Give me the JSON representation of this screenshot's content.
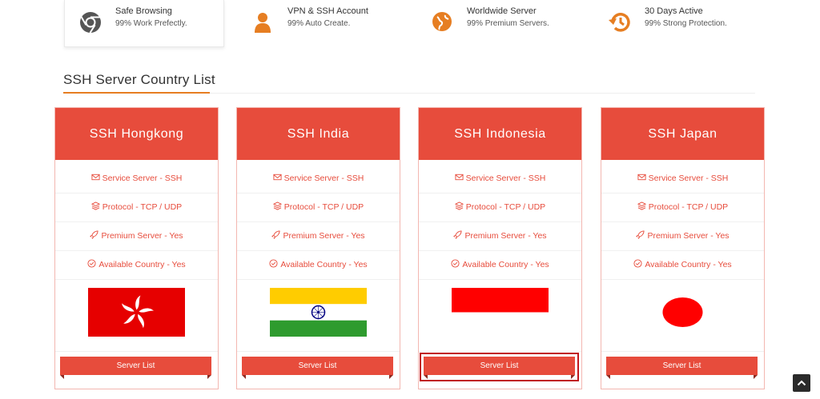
{
  "features": [
    {
      "title": "Safe Browsing",
      "subtitle": "99% Work Prefectly.",
      "icon": "chrome-icon"
    },
    {
      "title": "VPN & SSH Account",
      "subtitle": "99% Auto Create.",
      "icon": "user-icon"
    },
    {
      "title": "Worldwide Server",
      "subtitle": "99% Premium Servers.",
      "icon": "globe-icon"
    },
    {
      "title": "30 Days Active",
      "subtitle": "99% Strong Protection.",
      "icon": "history-icon"
    }
  ],
  "section": {
    "title": "SSH Server Country List"
  },
  "cards": [
    {
      "title": "SSH Hongkong",
      "flag": "hongkong",
      "rows": [
        "Service Server - SSH",
        "Protocol - TCP / UDP",
        "Premium Server - Yes",
        "Available Country - Yes"
      ],
      "button": "Server List"
    },
    {
      "title": "SSH India",
      "flag": "india",
      "rows": [
        "Service Server - SSH",
        "Protocol - TCP / UDP",
        "Premium Server - Yes",
        "Available Country - Yes"
      ],
      "button": "Server List"
    },
    {
      "title": "SSH Indonesia",
      "flag": "indonesia",
      "rows": [
        "Service Server - SSH",
        "Protocol - TCP / UDP",
        "Premium Server - Yes",
        "Available Country - Yes"
      ],
      "button": "Server List"
    },
    {
      "title": "SSH Japan",
      "flag": "japan",
      "rows": [
        "Service Server - SSH",
        "Protocol - TCP / UDP",
        "Premium Server - Yes",
        "Available Country - Yes"
      ],
      "button": "Server List"
    }
  ],
  "colors": {
    "accent": "#e74c3c",
    "icon_orange": "#e67e22",
    "underline": "#e67e22"
  },
  "scroll_top": {
    "icon": "chevron-up-icon"
  }
}
